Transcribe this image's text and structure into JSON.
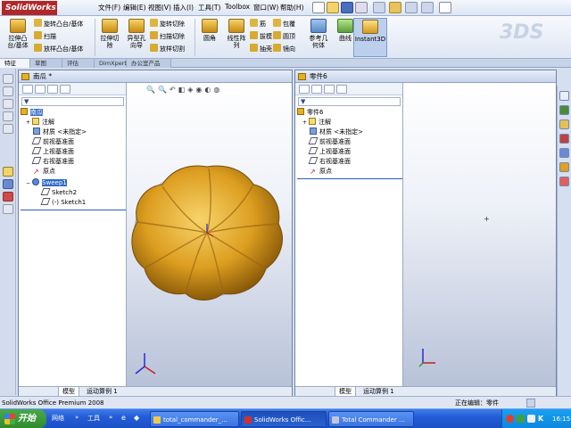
{
  "app": {
    "logo": "SolidWorks"
  },
  "menu": [
    "文件(F)",
    "编辑(E)",
    "视图(V)",
    "插入(I)",
    "工具(T)",
    "Toolbox",
    "窗口(W)",
    "帮助(H)"
  ],
  "command_manager": {
    "big_buttons": [
      {
        "label": "拉伸凸\n台/基体"
      },
      {
        "label": "拉伸切\n除"
      },
      {
        "label": "异型孔\n向导"
      },
      {
        "label": "圆角"
      },
      {
        "label": "线性阵\n列"
      },
      {
        "label": "参考几\n何体"
      },
      {
        "label": "曲线"
      },
      {
        "label": "Instant3D"
      }
    ],
    "small_col1": [
      "旋转凸台/基体",
      "扫描",
      "放样凸台/基体"
    ],
    "small_col2": [
      "旋转切除",
      "扫描切除",
      "放样切割"
    ],
    "small_col3": [
      "筋",
      "拔模",
      "抽壳"
    ],
    "small_col4": [
      "包覆",
      "圆顶",
      "镜向"
    ]
  },
  "cmd_tabs": [
    "特征",
    "草图",
    "评估",
    "DimXpert",
    "办公室产品"
  ],
  "left_doc": {
    "title": "南瓜 *",
    "root": "南瓜",
    "tree": [
      {
        "label": "注解"
      },
      {
        "label": "材质 <未指定>"
      },
      {
        "label": "前视基准面"
      },
      {
        "label": "上视基准面"
      },
      {
        "label": "右视基准面"
      },
      {
        "label": "原点"
      },
      {
        "label": "Sweep1"
      },
      {
        "label": "Sketch2"
      },
      {
        "label": "(-) Sketch1"
      }
    ],
    "bottom_tabs": [
      "模型",
      "运动算例 1"
    ]
  },
  "right_doc": {
    "title": "零件6",
    "root": "零件6",
    "tree": [
      {
        "label": "注解"
      },
      {
        "label": "材质 <未指定>"
      },
      {
        "label": "前视基准面"
      },
      {
        "label": "上视基准面"
      },
      {
        "label": "右视基准面"
      },
      {
        "label": "原点"
      }
    ],
    "bottom_tabs": [
      "模型",
      "运动算例 1"
    ]
  },
  "status": {
    "left": "SolidWorks Office Premium 2008",
    "right": "正在编辑：零件"
  },
  "taskbar": {
    "start": "开始",
    "quicklaunch": [
      "网络",
      "工具"
    ],
    "tasks": [
      "total_commander_...",
      "SolidWorks Offic...",
      "Total Commander ..."
    ],
    "clock": "16:15"
  },
  "colors": {
    "accent": "#316ac5",
    "pumpkin": "#e0a21c",
    "logo": "#b0282a"
  }
}
